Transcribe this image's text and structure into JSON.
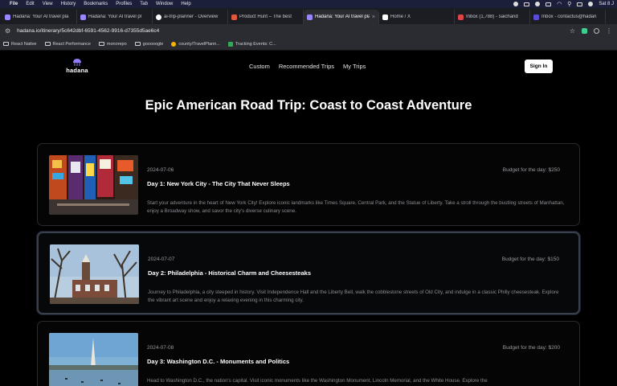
{
  "menubar": {
    "items": [
      "File",
      "Edit",
      "View",
      "History",
      "Bookmarks",
      "Profiles",
      "Tab",
      "Window",
      "Help"
    ],
    "clock": "Sat 8 J"
  },
  "tabs": [
    {
      "title": "Hadana: Your AI travel pla",
      "icon": "hadana-icon",
      "active": false
    },
    {
      "title": "Hadana: Your AI travel pl",
      "icon": "hadana-icon",
      "active": false
    },
    {
      "title": "ai-trip-planner - Overview",
      "icon": "github-icon",
      "active": false
    },
    {
      "title": "Product Hunt – The best",
      "icon": "producthunt-icon",
      "active": false
    },
    {
      "title": "Hadana: Your AI travel pla",
      "icon": "hadana-icon",
      "active": true
    },
    {
      "title": "Home / X",
      "icon": "x-icon",
      "active": false
    },
    {
      "title": "Inbox (1,788) - saichand",
      "icon": "gmail-icon",
      "active": false
    },
    {
      "title": "Inbox - contactus@hadan",
      "icon": "inbox-icon",
      "active": false
    }
  ],
  "address_bar": {
    "url": "hadana.io/itinerary/5c642dbf-6591-4562-9916-d7355d5ae6c4"
  },
  "bookmarks": [
    {
      "label": "React Native",
      "icon": "folder-icon"
    },
    {
      "label": "React Performance",
      "icon": "folder-icon"
    },
    {
      "label": "monorepo",
      "icon": "folder-icon"
    },
    {
      "label": "gooooogle",
      "icon": "folder-icon"
    },
    {
      "label": "county/TravelPlann...",
      "icon": "google-icon"
    },
    {
      "label": "Tracking Events: C...",
      "icon": "tracker-icon"
    }
  ],
  "site": {
    "logo_text": "hadana",
    "nav": [
      "Custom",
      "Recommended Trips",
      "My Trips"
    ],
    "sign_in": "Sign In"
  },
  "trip": {
    "title": "Epic American Road Trip: Coast to Coast Adventure",
    "days": [
      {
        "date": "2024-07-06",
        "budget": "Budget for the day: $250",
        "title": "Day 1: New York City - The City That Never Sleeps",
        "description": "Start your adventure in the heart of New York City! Explore iconic landmarks like Times Square, Central Park, and the Statue of Liberty. Take a stroll through the bustling streets of Manhattan, enjoy a Broadway show, and savor the city's diverse culinary scene.",
        "photo": "times-square-photo"
      },
      {
        "date": "2024-07-07",
        "budget": "Budget for the day: $150",
        "title": "Day 2: Philadelphia - Historical Charm and Cheesesteaks",
        "description": "Journey to Philadelphia, a city steeped in history. Visit Independence Hall and the Liberty Bell, walk the cobblestone streets of Old City, and indulge in a classic Philly cheesesteak. Explore the vibrant art scene and enjoy a relaxing evening in this charming city.",
        "photo": "independence-hall-photo"
      },
      {
        "date": "2024-07-08",
        "budget": "Budget for the day: $200",
        "title": "Day 3: Washington D.C. - Monuments and Politics",
        "description": "Head to Washington D.C., the nation's capital. Visit iconic monuments like the Washington Monument, Lincoln Memorial, and the White House. Explore the",
        "photo": "washington-monument-photo"
      }
    ]
  },
  "colors": {
    "background": "#000000",
    "card_border": "#2a2a2e",
    "muted_text": "#8d8d93",
    "menubar": "#1b1f3a"
  }
}
